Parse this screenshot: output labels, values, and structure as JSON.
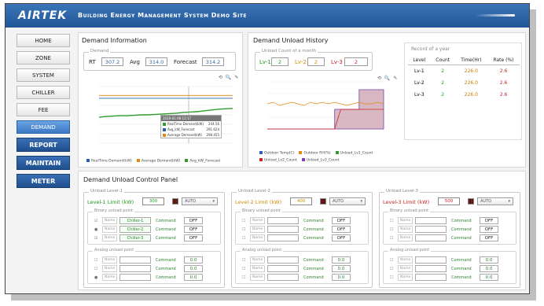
{
  "header": {
    "logo": "AIRTEK",
    "title": "Building Energy Management System Demo Site"
  },
  "nav": [
    {
      "label": "HOME",
      "style": "normal"
    },
    {
      "label": "ZONE",
      "style": "normal"
    },
    {
      "label": "SYSTEM",
      "style": "normal"
    },
    {
      "label": "CHILLER",
      "style": "normal"
    },
    {
      "label": "FEE",
      "style": "normal"
    },
    {
      "label": "DEMAND",
      "style": "active"
    },
    {
      "label": "REPORT",
      "style": "dark"
    },
    {
      "label": "MAINTAIN",
      "style": "dark"
    },
    {
      "label": "METER",
      "style": "dark"
    }
  ],
  "demand_info": {
    "title": "Demand Information",
    "legend": "Demand",
    "rt_label": "RT",
    "rt_value": "307.2",
    "avg_label": "Avg",
    "avg_value": "314.0",
    "forecast_label": "Forecast",
    "forecast_value": "314.2",
    "chart_tools": "⟲ 🔍 ✎",
    "tooltip_title": "2019-01-08 12:17",
    "tooltip": [
      {
        "label": "RealTime Demand(kW)",
        "value": "244.56"
      },
      {
        "label": "Avg_kW_Forecast",
        "value": "291.624"
      },
      {
        "label": "Average Demand(kW)",
        "value": "298.455"
      }
    ],
    "series_legend": [
      "RealTime Demand(kW)",
      "Average Demand(kW)",
      "Avg_kW_Forecast"
    ]
  },
  "unload_history": {
    "title": "Demand Unload History",
    "legend": "Unload Count of a month",
    "lv1_label": "Lv-1",
    "lv1_value": "2",
    "lv2_label": "Lv-2",
    "lv2_value": "2",
    "lv3_label": "Lv-3",
    "lv3_value": "2",
    "chart_tools": "⟲ 🔍 ✎",
    "series_legend": [
      "Outdoor Temp(C)",
      "Outdoor RH(%)",
      "Unload_Lv1_Count",
      "Unload_Lv2_Count",
      "Unload_Lv3_Count"
    ]
  },
  "record": {
    "title": "Record of a year",
    "headers": [
      "Level",
      "Count",
      "Time(Hr)",
      "Rate (%)"
    ],
    "rows": [
      [
        "Lv-1",
        "2",
        "226.0",
        "2.6"
      ],
      [
        "Lv-2",
        "2",
        "226.0",
        "2.6"
      ],
      [
        "Lv-3",
        "2",
        "226.0",
        "2.6"
      ]
    ]
  },
  "control": {
    "title": "Demand Unload Control Panel",
    "levels": [
      {
        "legend": "Unload Level-1",
        "limit_label": "Level-1 Limit (kW)",
        "limit_value": "300",
        "mode": "AUTO",
        "binary_legend": "Binary unload point",
        "binary": [
          {
            "mark": "☑",
            "name_label": "Name",
            "name": "Chiller-1",
            "cmd_label": "Command",
            "cmd": "OFF"
          },
          {
            "mark": "●",
            "name_label": "Name",
            "name": "Chiller-2",
            "cmd_label": "Command",
            "cmd": "OFF"
          },
          {
            "mark": "☑",
            "name_label": "Name",
            "name": "Chiller-3",
            "cmd_label": "Command",
            "cmd": "OFF"
          }
        ],
        "analog_legend": "Analog unload point",
        "analog": [
          {
            "mark": "☐",
            "name_label": "Name",
            "name": "",
            "cmd_label": "Command",
            "cmd": "0.0"
          },
          {
            "mark": "☐",
            "name_label": "Name",
            "name": "",
            "cmd_label": "Command",
            "cmd": "0.0"
          },
          {
            "mark": "●",
            "name_label": "Name",
            "name": "",
            "cmd_label": "Command",
            "cmd": "0.0"
          }
        ]
      },
      {
        "legend": "Unload Level-2",
        "limit_label": "Level-2 Limit (kW)",
        "limit_value": "400",
        "mode": "AUTO",
        "binary_legend": "Binary unload point",
        "binary": [
          {
            "mark": "☐",
            "name_label": "Name",
            "name": "",
            "cmd_label": "Command",
            "cmd": "OFF"
          },
          {
            "mark": "☐",
            "name_label": "Name",
            "name": "",
            "cmd_label": "Command",
            "cmd": "OFF"
          },
          {
            "mark": "☐",
            "name_label": "Name",
            "name": "",
            "cmd_label": "Command",
            "cmd": "OFF"
          }
        ],
        "analog_legend": "Analog unload point",
        "analog": [
          {
            "mark": "☐",
            "name_label": "Name",
            "name": "",
            "cmd_label": "Command",
            "cmd": "0.0"
          },
          {
            "mark": "☐",
            "name_label": "Name",
            "name": "",
            "cmd_label": "Command",
            "cmd": "0.0"
          },
          {
            "mark": "☐",
            "name_label": "Name",
            "name": "",
            "cmd_label": "Command",
            "cmd": "0.0"
          }
        ]
      },
      {
        "legend": "Unload Level-3",
        "limit_label": "Level-3 Limit (kW)",
        "limit_value": "500",
        "mode": "AUTO",
        "binary_legend": "Binary unload point",
        "binary": [
          {
            "mark": "☐",
            "name_label": "Name",
            "name": "",
            "cmd_label": "Command",
            "cmd": "OFF"
          },
          {
            "mark": "☐",
            "name_label": "Name",
            "name": "",
            "cmd_label": "Command",
            "cmd": "OFF"
          },
          {
            "mark": "☐",
            "name_label": "Name",
            "name": "",
            "cmd_label": "Command",
            "cmd": "OFF"
          }
        ],
        "analog_legend": "Analog unload point",
        "analog": [
          {
            "mark": "☐",
            "name_label": "Name",
            "name": "",
            "cmd_label": "Command",
            "cmd": "0.0"
          },
          {
            "mark": "☐",
            "name_label": "Name",
            "name": "",
            "cmd_label": "Command",
            "cmd": "0.0"
          },
          {
            "mark": "☐",
            "name_label": "Name",
            "name": "",
            "cmd_label": "Command",
            "cmd": "0.0"
          }
        ]
      }
    ]
  },
  "colors": {
    "header": "#2a63a8",
    "realtime": "#2e9b2e",
    "average": "#e08a10",
    "forecast": "#2b5fb0",
    "lv1": "#1b9b1b",
    "lv2": "#d08a00",
    "lv3": "#cc2222",
    "unload_fill": "#b87f92"
  },
  "chart_data": [
    {
      "type": "line",
      "series": [
        {
          "name": "RealTime Demand(kW)",
          "values": [
            244,
            246,
            247,
            248,
            248,
            249,
            250,
            250,
            251,
            252,
            253,
            254,
            256,
            257,
            258,
            260,
            262,
            264,
            265,
            266
          ]
        },
        {
          "name": "Average Demand(kW)",
          "values": [
            298,
            298,
            298,
            298,
            298,
            298,
            298,
            298,
            298,
            298,
            298,
            298,
            298,
            298,
            298,
            298,
            298,
            298,
            298,
            298
          ]
        },
        {
          "name": "Avg_kW_Forecast",
          "values": [
            291,
            291,
            291,
            291,
            291,
            291,
            291,
            291,
            291,
            291,
            291,
            291,
            291,
            291,
            291,
            291,
            291,
            291,
            291,
            291
          ]
        }
      ]
    },
    {
      "type": "area",
      "series": [
        {
          "name": "Unload_Lv1_Count",
          "values": [
            0,
            0,
            0,
            0,
            0,
            0,
            0,
            0,
            0,
            0,
            0,
            0,
            1,
            1,
            1,
            1,
            1,
            1,
            1,
            1
          ]
        },
        {
          "name": "Unload_Lv3_Count",
          "values": [
            0,
            0,
            0,
            0,
            0,
            0,
            0,
            0,
            0,
            0,
            0,
            1,
            1,
            1,
            1,
            2,
            2,
            2,
            2,
            2
          ]
        },
        {
          "name": "Outdoor Temp(C)",
          "values": [
            26,
            27,
            25,
            26,
            27,
            26,
            25,
            27,
            26,
            27,
            26,
            27,
            26,
            25,
            26,
            27,
            26,
            26,
            27,
            26
          ]
        }
      ]
    }
  ]
}
